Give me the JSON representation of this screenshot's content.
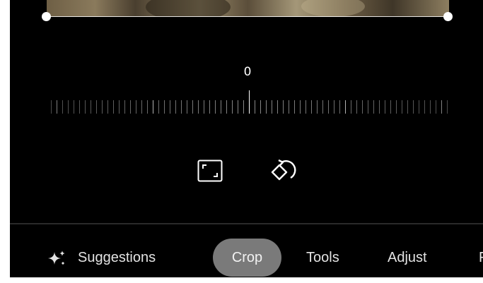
{
  "editor": {
    "angle_value": "0"
  },
  "tabs": {
    "suggestions": "Suggestions",
    "crop": "Crop",
    "tools": "Tools",
    "adjust": "Adjust",
    "next_partial": "F"
  },
  "icons": {
    "aspect": "aspect-ratio-icon",
    "rotate": "rotate-icon",
    "suggestions": "sparkle-icon"
  },
  "colors": {
    "background": "#000000",
    "selected_tab": "#7a7a7a",
    "text": "#e3e3e3"
  }
}
